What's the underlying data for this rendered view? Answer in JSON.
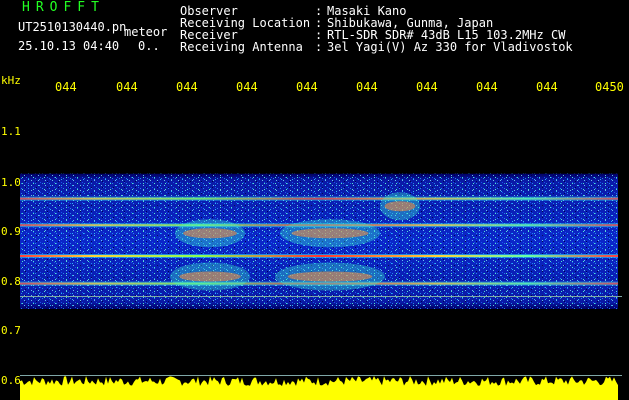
{
  "header": {
    "app_title": "HROFFT",
    "file_name": "UT2510130440.pn",
    "mode_label": "meteor",
    "date_time": "25.10.13 04:40",
    "frame_count": "0.."
  },
  "station_info": [
    {
      "key": "Observer",
      "value": "Masaki Kano"
    },
    {
      "key": "Receiving Location",
      "value": "Shibukawa, Gunma, Japan"
    },
    {
      "key": "Receiver",
      "value": "RTL-SDR SDR# 43dB L15 103.2MHz CW"
    },
    {
      "key": "Receiving Antenna",
      "value": "3el Yagi(V) Az 330 for Vladivostok"
    }
  ],
  "separator": ":",
  "spectrogram": {
    "unit": "kHz",
    "freq_ticks": [
      {
        "label": "1.1",
        "value": 1.1
      },
      {
        "label": "1.0",
        "value": 1.0
      },
      {
        "label": "0.9",
        "value": 0.9
      },
      {
        "label": "0.8",
        "value": 0.8
      },
      {
        "label": "0.7",
        "value": 0.7
      },
      {
        "label": "0.6",
        "value": 0.6
      }
    ],
    "time_ticks": [
      "044",
      "044",
      "044",
      "044",
      "044",
      "044",
      "044",
      "044",
      "044",
      "0450"
    ],
    "freq_range": [
      0.6,
      1.16
    ],
    "signal_band": [
      0.77,
      1.02
    ],
    "strong_lines": [
      0.974,
      0.925,
      0.868,
      0.817
    ],
    "colors": {
      "background": "#000000",
      "label": "#ffff00",
      "title": "#22ff22",
      "text": "#ffffff",
      "amplitude": "#ffff00"
    }
  }
}
